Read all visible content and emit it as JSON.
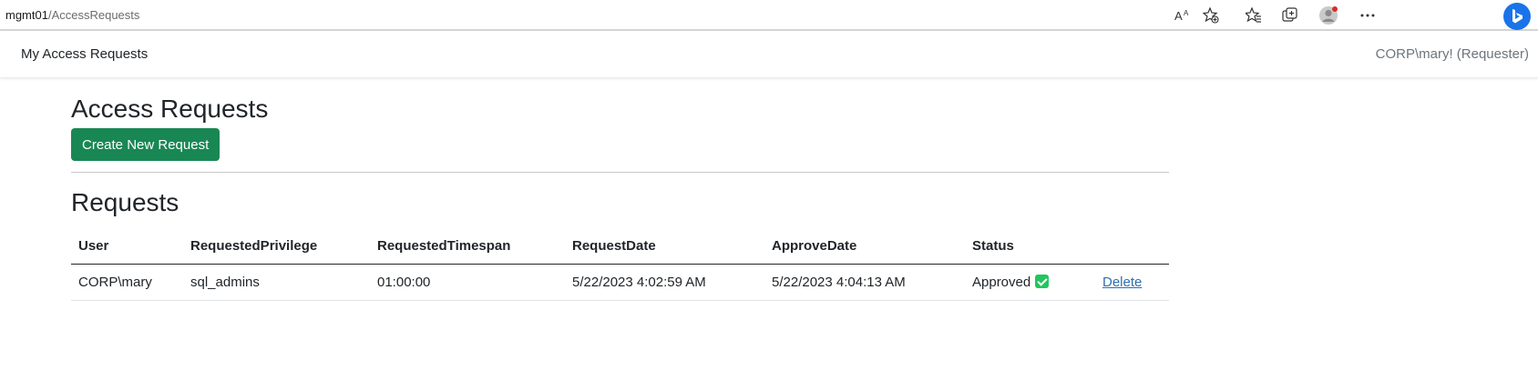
{
  "browser": {
    "url_host": "mgmt01",
    "url_path": "/AccessRequests",
    "icons": [
      "read-aloud-icon",
      "favorite-add-icon",
      "favorites-icon",
      "collections-icon",
      "profile-icon",
      "more-icon",
      "bing-icon"
    ]
  },
  "navbar": {
    "brand": "My Access Requests",
    "user": "CORP\\mary! (Requester)"
  },
  "main": {
    "title": "Access Requests",
    "create_button": "Create New Request",
    "requests_heading": "Requests"
  },
  "table": {
    "headers": [
      "User",
      "RequestedPrivilege",
      "RequestedTimespan",
      "RequestDate",
      "ApproveDate",
      "Status",
      ""
    ],
    "rows": [
      {
        "user": "CORP\\mary",
        "privilege": "sql_admins",
        "timespan": "01:00:00",
        "request_date": "5/22/2023 4:02:59 AM",
        "approve_date": "5/22/2023 4:04:13 AM",
        "status": "Approved",
        "action": "Delete"
      }
    ]
  },
  "colors": {
    "primary_button": "#198754",
    "status_check": "#22c55e",
    "link": "#2f6fb0"
  }
}
